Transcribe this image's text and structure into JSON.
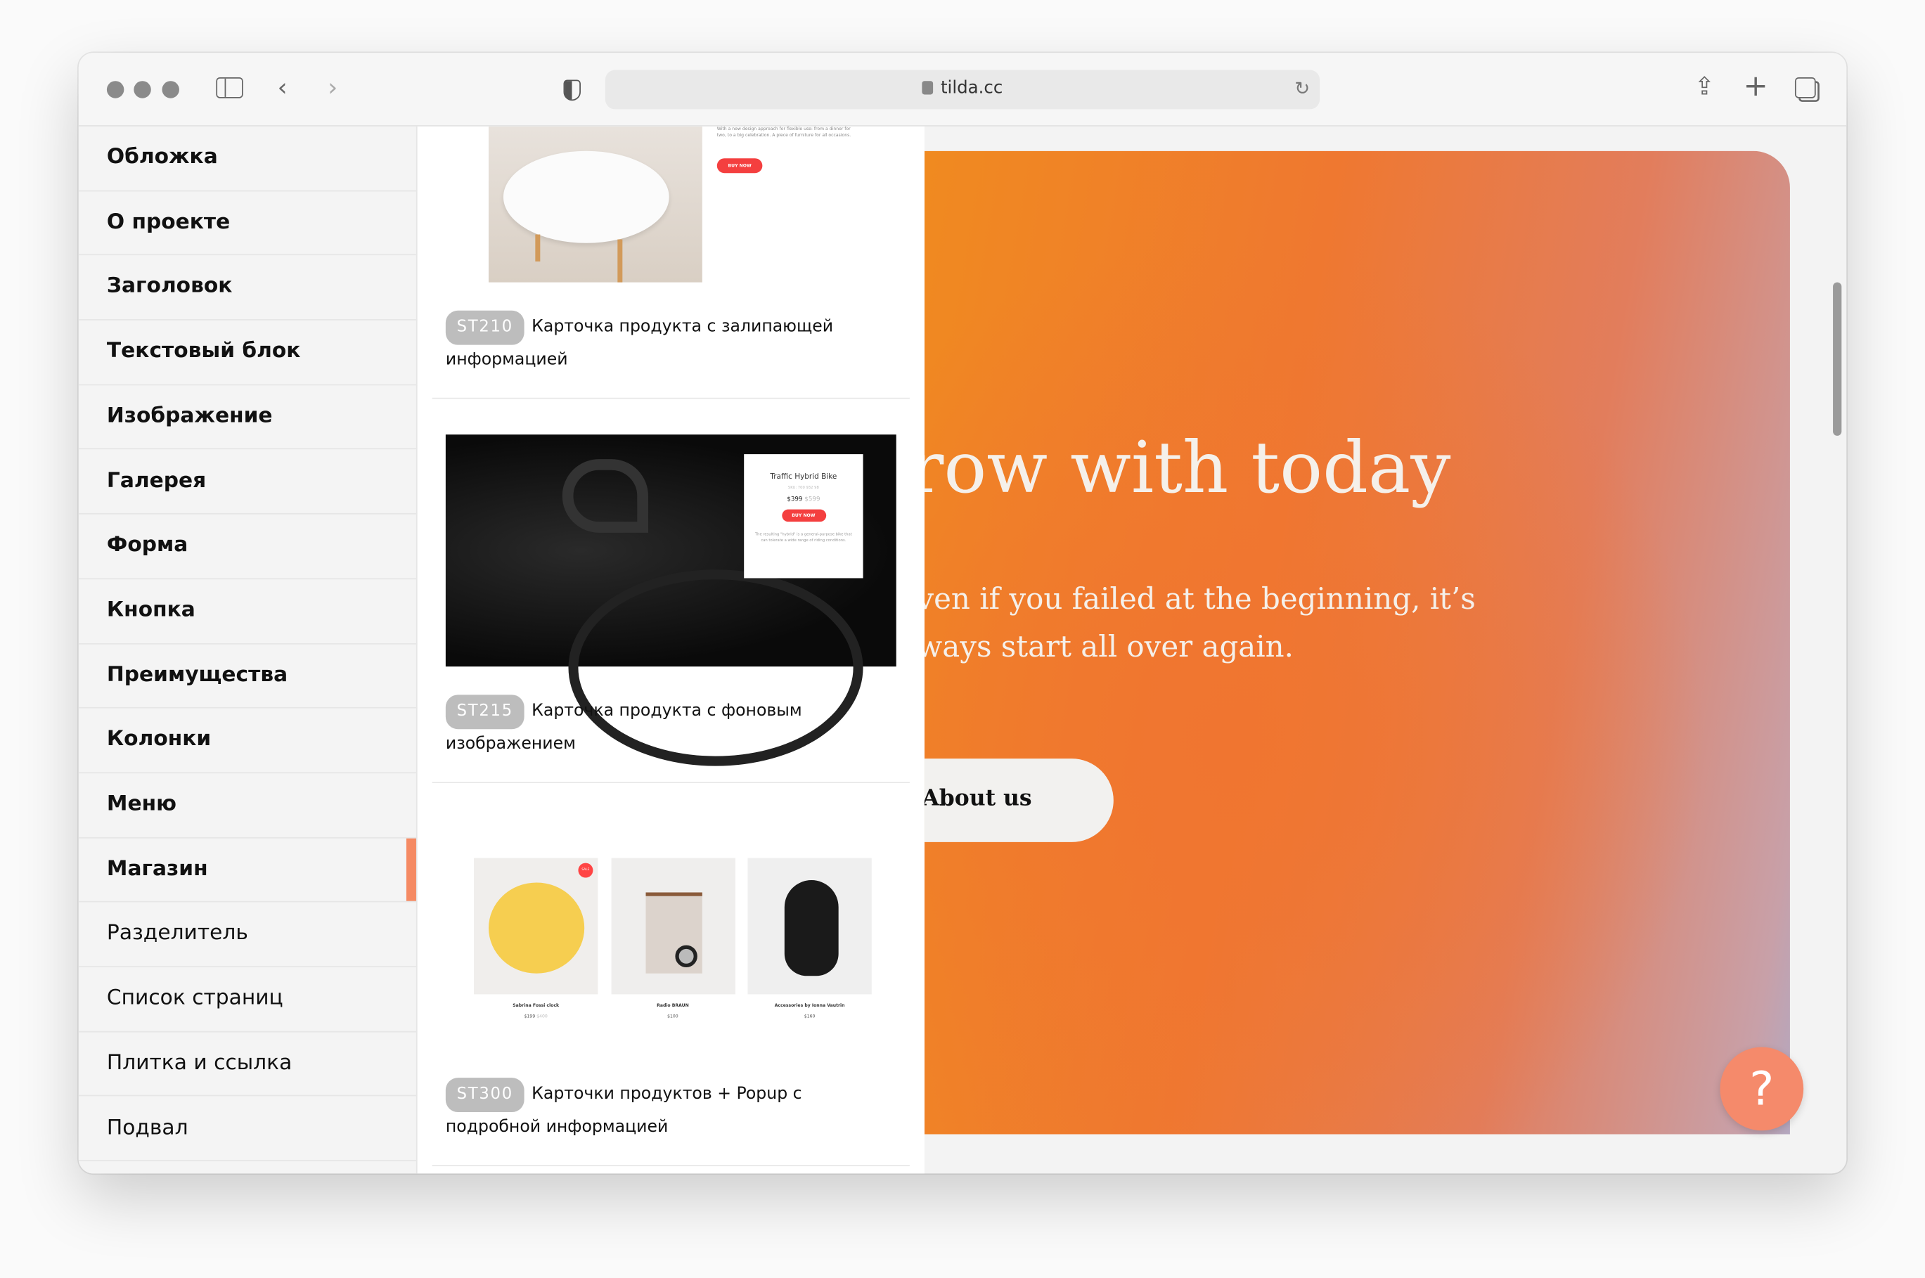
{
  "browser": {
    "url": "tilda.cc"
  },
  "sidebar": {
    "items": [
      {
        "label": "Обложка",
        "bold": true
      },
      {
        "label": "О проекте",
        "bold": true
      },
      {
        "label": "Заголовок",
        "bold": true
      },
      {
        "label": "Текстовый блок",
        "bold": true
      },
      {
        "label": "Изображение",
        "bold": true
      },
      {
        "label": "Галерея",
        "bold": true
      },
      {
        "label": "Форма",
        "bold": true
      },
      {
        "label": "Кнопка",
        "bold": true
      },
      {
        "label": "Преимущества",
        "bold": true
      },
      {
        "label": "Колонки",
        "bold": true
      },
      {
        "label": "Меню",
        "bold": true
      },
      {
        "label": "Магазин",
        "bold": true,
        "active": true
      },
      {
        "label": "Разделитель",
        "bold": false
      },
      {
        "label": "Список страниц",
        "bold": false
      },
      {
        "label": "Плитка и ссылка",
        "bold": false
      },
      {
        "label": "Подвал",
        "bold": false
      }
    ],
    "active_color": "#f58a63"
  },
  "cards": [
    {
      "code": "ST210",
      "title": "Карточка продукта с залипающей информацией",
      "preview": {
        "text": "With a new design approach for flexible use: from a dinner for two, to a big celebration. A piece of furniture for all occasions.",
        "button": "BUY NOW"
      }
    },
    {
      "code": "ST215",
      "title": "Карточка продукта с фоновым изображением",
      "preview": {
        "name": "Traffic Hybrid Bike",
        "sku": "SKU: 700 932 98",
        "price": "$399",
        "old_price": "$599",
        "button": "BUY NOW",
        "text": "The resulting \"hybrid\" is a general-purpose bike that can tolerate a wide range of riding conditions."
      }
    },
    {
      "code": "ST300",
      "title": "Карточки продуктов + Popup с подробной информацией",
      "preview": {
        "products": [
          {
            "name": "Sabrina Fossi clock",
            "price": "$199",
            "old_price": "$400",
            "badge": "SALE"
          },
          {
            "name": "Radio BRAUN",
            "price": "$100"
          },
          {
            "name": "Accessories by Ionna Vautrin",
            "price": "$160"
          }
        ]
      }
    }
  ],
  "hero": {
    "title": "row with today",
    "text": "ven if you failed at the beginning, it’s ways start all over again.",
    "button": "About us"
  },
  "help": {
    "label": "?",
    "color": "#f58a6b"
  }
}
